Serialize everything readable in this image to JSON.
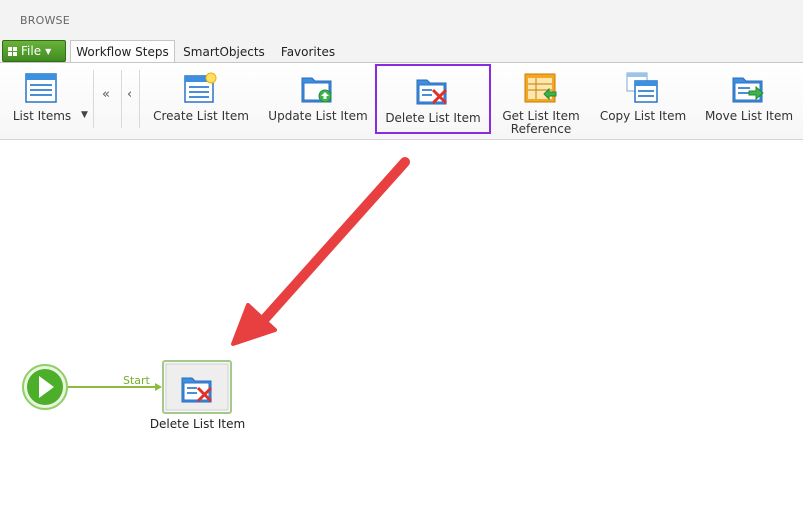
{
  "header": {
    "browse_label": "BROWSE"
  },
  "file_menu": {
    "label": "File"
  },
  "tabs": [
    {
      "label": "Workflow Steps"
    },
    {
      "label": "SmartObjects"
    },
    {
      "label": "Favorites"
    }
  ],
  "ribbon": {
    "dropdown": {
      "label": "List Items"
    },
    "items": [
      {
        "label": "Create List Item"
      },
      {
        "label": "Update List Item"
      },
      {
        "label": "Delete List Item"
      },
      {
        "label_line1": "Get List Item",
        "label_line2": "Reference"
      },
      {
        "label": "Copy List Item"
      },
      {
        "label": "Move List Item"
      }
    ],
    "highlight_color": "#8a2be2"
  },
  "workflow": {
    "start_link_label": "Start",
    "node_label": "Delete List Item",
    "start_color": "#4caf2a",
    "link_color": "#8dbb3c",
    "arrow_color": "#e84040"
  }
}
